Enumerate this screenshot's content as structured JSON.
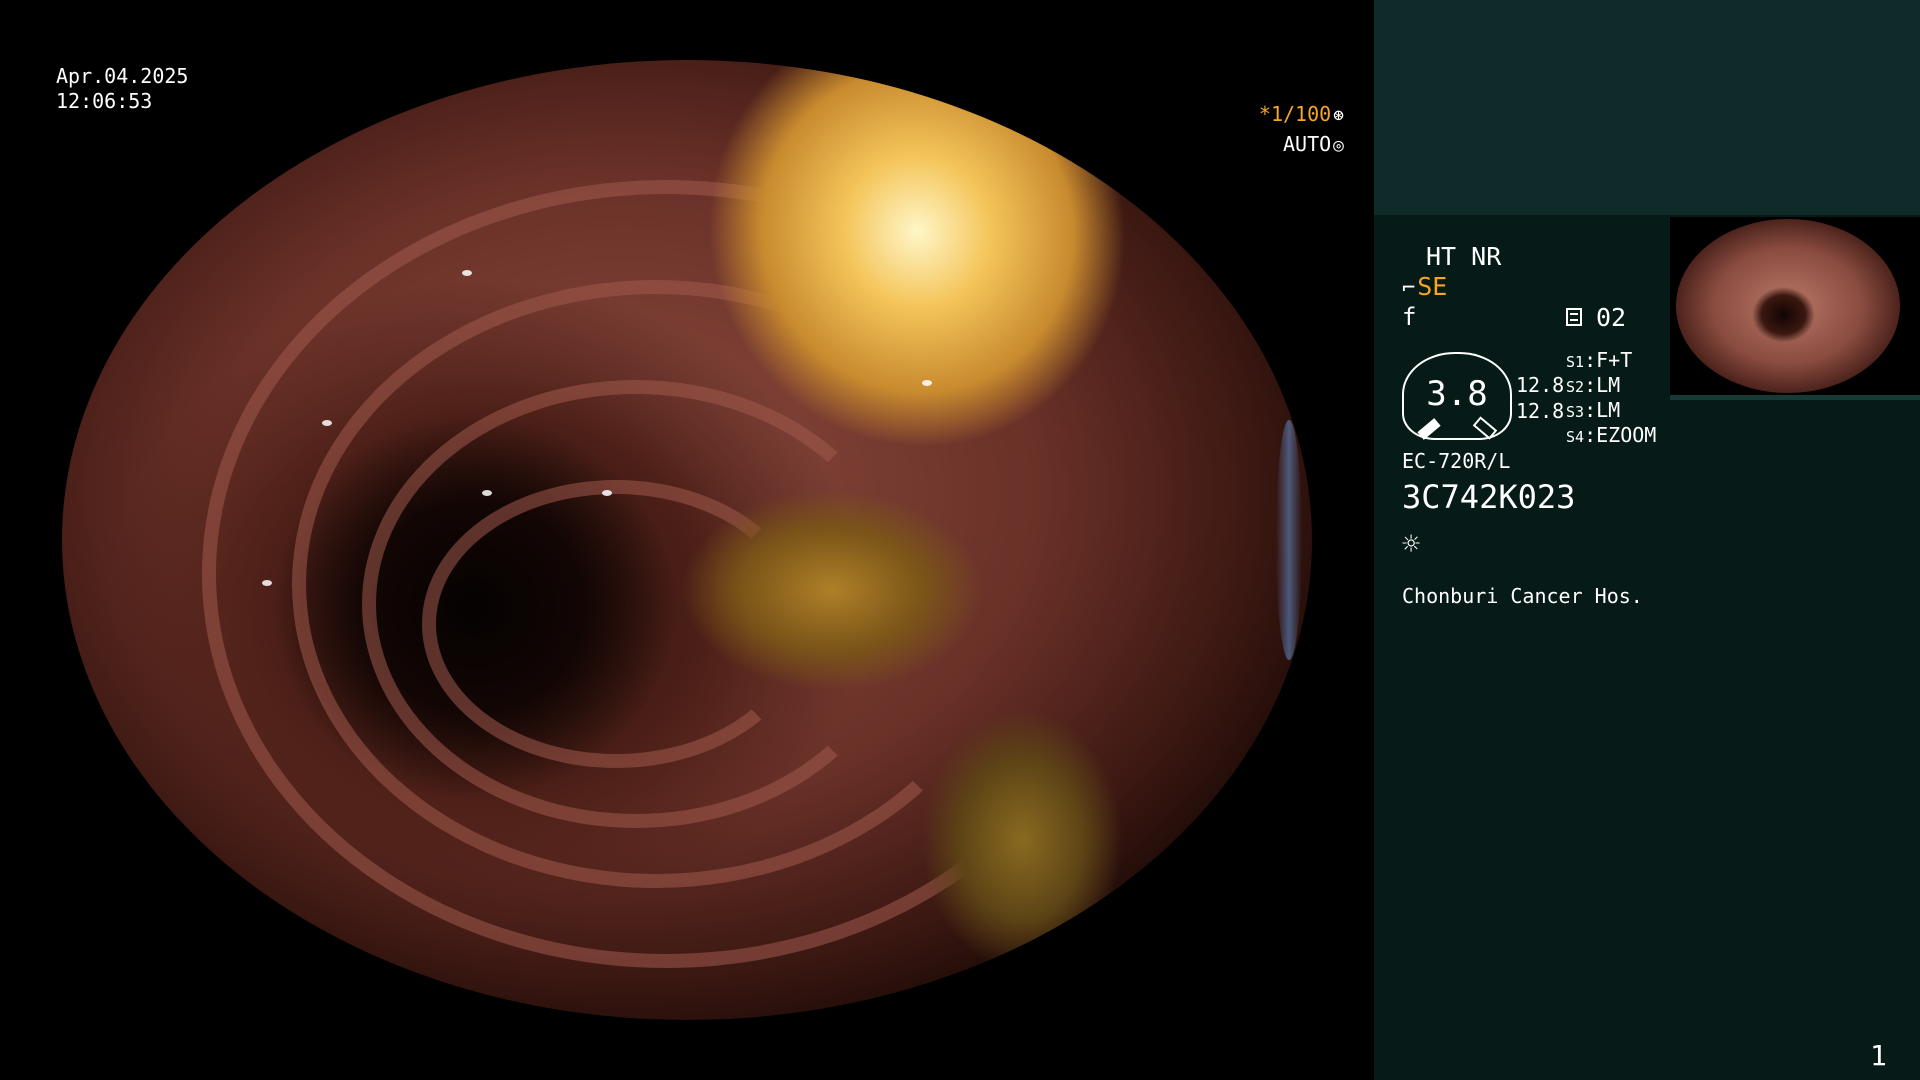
{
  "overlay": {
    "date": "Apr.04.2025",
    "time": "12:06:53",
    "shutter_speed": "*1/100",
    "shutter_icon": "aperture-icon",
    "exposure_mode": "AUTO",
    "exposure_icon": "iris-icon"
  },
  "panel": {
    "mode_line": "HT NR",
    "se_label": "SE",
    "se_icon": "scope-tip-icon",
    "f_label": "f",
    "memo_icon": "memo-icon",
    "memo_number": "02",
    "gauge_value": "3.8",
    "val_a": "12.8",
    "val_b": "12.8",
    "switches": [
      {
        "key": "S1",
        "value": "F+T"
      },
      {
        "key": "S2",
        "value": "LM"
      },
      {
        "key": "S3",
        "value": "LM"
      },
      {
        "key": "S4",
        "value": "EZOOM"
      }
    ],
    "scope_model": "EC-720R/L",
    "serial": "3C742K023",
    "light_icon": "sun-icon",
    "hospital": "Chonburi Cancer Hos.",
    "page_number": "1"
  },
  "colors": {
    "panel_bg": "#061b18",
    "panel_top_band": "#0e2b29",
    "accent_orange": "#f5a623",
    "text": "#ffffff"
  }
}
